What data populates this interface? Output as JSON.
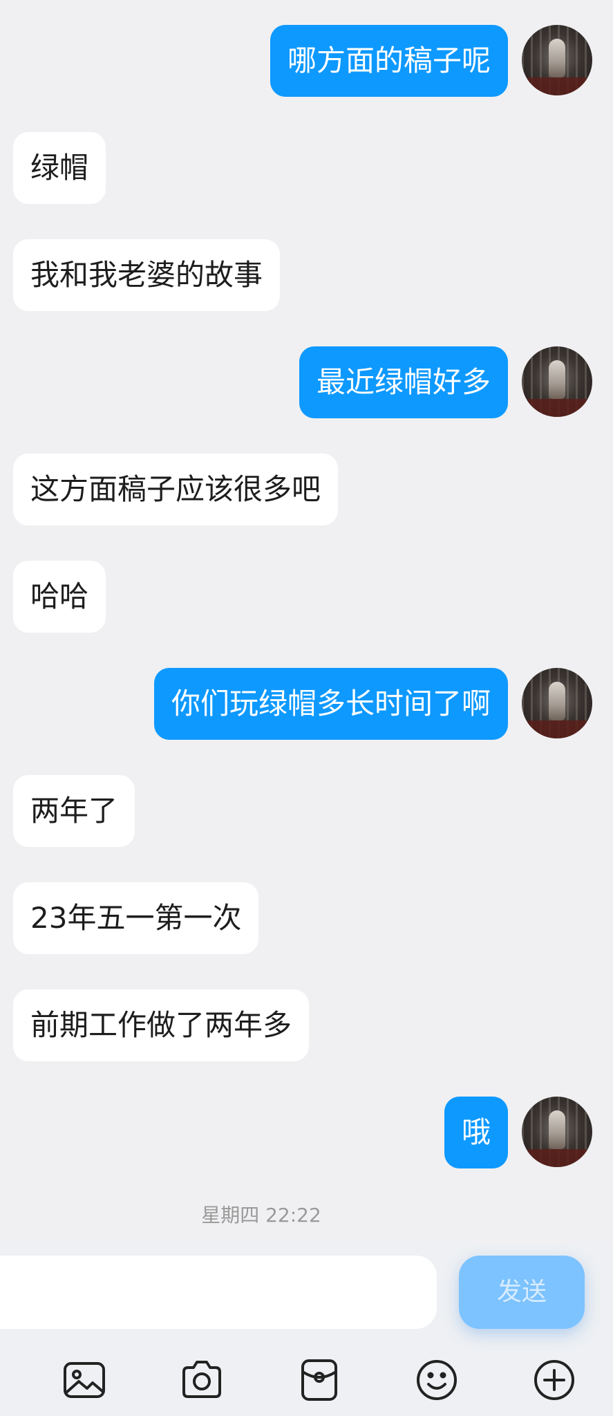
{
  "chat": {
    "messages": [
      {
        "side": "out",
        "text": "哪方面的稿子呢"
      },
      {
        "side": "in",
        "text": "绿帽"
      },
      {
        "side": "in",
        "text": "我和我老婆的故事"
      },
      {
        "side": "out",
        "text": "最近绿帽好多"
      },
      {
        "side": "in",
        "text": "这方面稿子应该很多吧"
      },
      {
        "side": "in",
        "text": "哈哈"
      },
      {
        "side": "out",
        "text": "你们玩绿帽多长时间了啊"
      },
      {
        "side": "in",
        "text": "两年了"
      },
      {
        "side": "in",
        "text": "23年五一第一次"
      },
      {
        "side": "in",
        "text": "前期工作做了两年多"
      },
      {
        "side": "out",
        "text": "哦"
      }
    ],
    "timestamp": "星期四 22:22"
  },
  "composer": {
    "input_value": "",
    "send_label": "发送"
  },
  "toolbar": {
    "icons": [
      "image-icon",
      "camera-icon",
      "red-packet-icon",
      "emoji-icon",
      "plus-icon"
    ]
  },
  "colors": {
    "outgoing_bubble": "#0e99ff",
    "incoming_bubble": "#ffffff",
    "background": "#f0f0f2",
    "send_button": "#7cc3ff"
  }
}
